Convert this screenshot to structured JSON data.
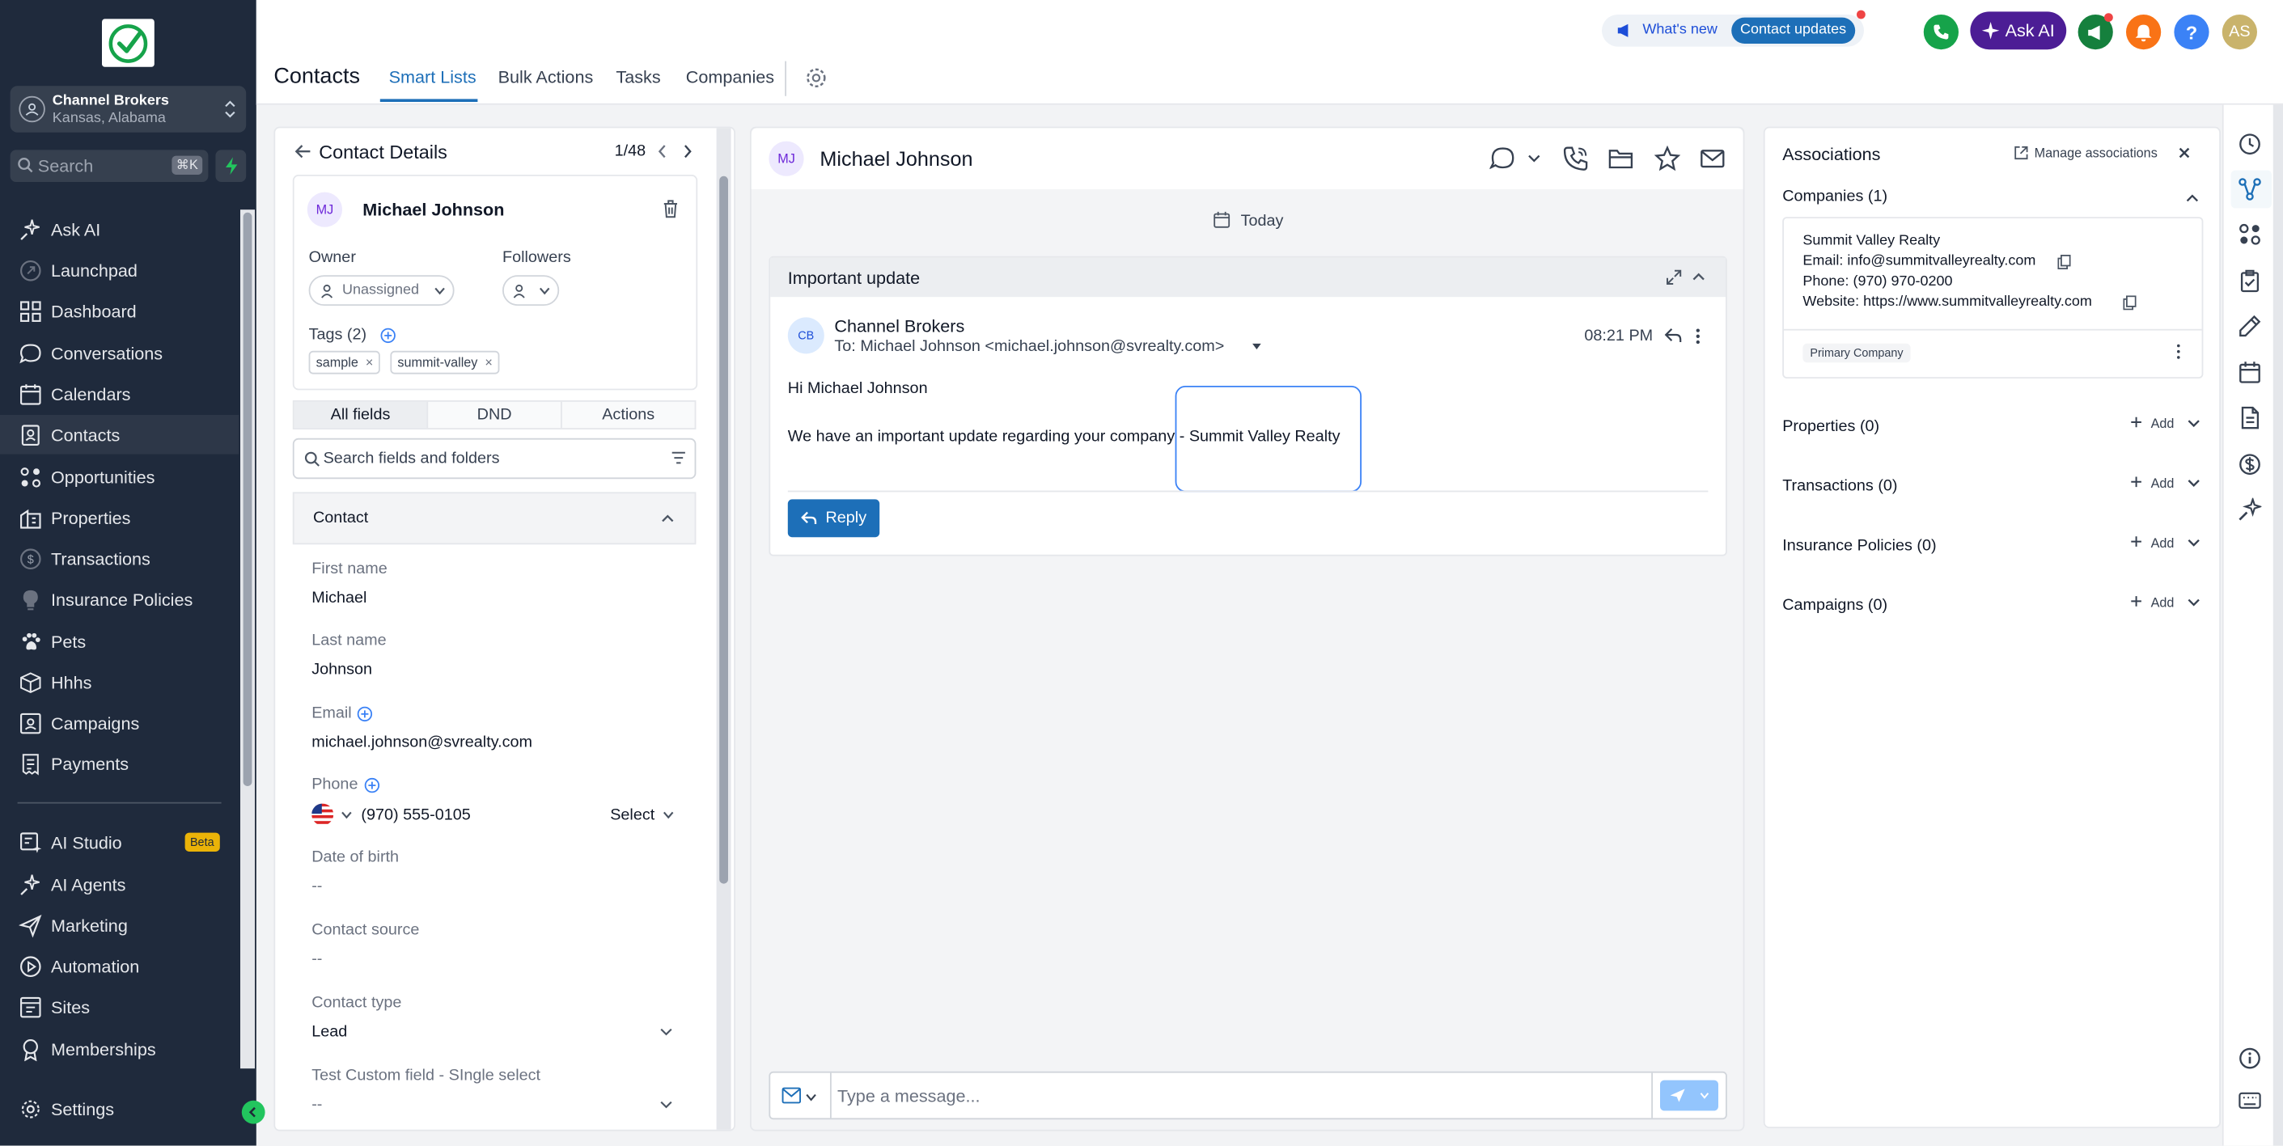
{
  "sidebar": {
    "account": {
      "name": "Channel Brokers",
      "location": "Kansas, Alabama"
    },
    "search": {
      "placeholder": "Search",
      "shortcut": "⌘K"
    },
    "items": [
      {
        "label": "Ask AI",
        "icon": "sparkles-icon"
      },
      {
        "label": "Launchpad",
        "icon": "rocket-icon"
      },
      {
        "label": "Dashboard",
        "icon": "grid-icon"
      },
      {
        "label": "Conversations",
        "icon": "chat-icon"
      },
      {
        "label": "Calendars",
        "icon": "calendar-icon"
      },
      {
        "label": "Contacts",
        "icon": "contacts-icon"
      },
      {
        "label": "Opportunities",
        "icon": "pipeline-icon"
      },
      {
        "label": "Properties",
        "icon": "building-icon"
      },
      {
        "label": "Transactions",
        "icon": "dollar-icon"
      },
      {
        "label": "Insurance Policies",
        "icon": "bulb-icon"
      },
      {
        "label": "Pets",
        "icon": "paw-icon"
      },
      {
        "label": "Hhhs",
        "icon": "box-icon"
      },
      {
        "label": "Campaigns",
        "icon": "campaign-icon"
      },
      {
        "label": "Payments",
        "icon": "receipt-icon"
      }
    ],
    "items2": [
      {
        "label": "AI Studio",
        "icon": "ai-studio-icon",
        "badge": "Beta"
      },
      {
        "label": "AI Agents",
        "icon": "sparkles-icon"
      },
      {
        "label": "Marketing",
        "icon": "send-icon"
      },
      {
        "label": "Automation",
        "icon": "automation-icon"
      },
      {
        "label": "Sites",
        "icon": "sites-icon"
      },
      {
        "label": "Memberships",
        "icon": "badge-icon"
      }
    ],
    "settings": "Settings"
  },
  "header": {
    "title": "Contacts",
    "tabs": [
      "Smart Lists",
      "Bulk Actions",
      "Tasks",
      "Companies"
    ],
    "whats_new": "What's new",
    "contact_updates": "Contact updates",
    "ask_ai": "Ask AI",
    "avatar": "AS"
  },
  "contact_details": {
    "back_title": "Contact Details",
    "pager": "1/48",
    "initials": "MJ",
    "name": "Michael Johnson",
    "owner_label": "Owner",
    "owner_value": "Unassigned",
    "followers_label": "Followers",
    "tags_label": "Tags (2)",
    "tags": [
      "sample",
      "summit-valley"
    ],
    "subtabs": [
      "All fields",
      "DND",
      "Actions"
    ],
    "search_placeholder": "Search fields and folders",
    "section": "Contact",
    "fields": {
      "first_name_label": "First name",
      "first_name": "Michael",
      "last_name_label": "Last name",
      "last_name": "Johnson",
      "email_label": "Email",
      "email": "michael.johnson@svrealty.com",
      "phone_label": "Phone",
      "phone": "(970) 555-0105",
      "phone_select": "Select",
      "dob_label": "Date of birth",
      "dob": "--",
      "source_label": "Contact source",
      "source": "--",
      "type_label": "Contact type",
      "type": "Lead",
      "custom_label": "Test Custom field - SIngle select",
      "custom": "--"
    }
  },
  "conversation": {
    "initials": "MJ",
    "name": "Michael Johnson",
    "date_chip": "Today",
    "subject": "Important update",
    "from_initials": "CB",
    "from": "Channel Brokers",
    "to": "To: Michael Johnson <michael.johnson@svrealty.com>",
    "time": "08:21 PM",
    "greeting": "Hi Michael Johnson",
    "body": "We have an important update regarding your company - Summit Valley Realty",
    "reply": "Reply",
    "composer_placeholder": "Type a message..."
  },
  "associations": {
    "title": "Associations",
    "manage": "Manage associations",
    "companies_label": "Companies (1)",
    "company": {
      "name": "Summit Valley Realty",
      "email": "Email: info@summitvalleyrealty.com",
      "phone": "Phone: (970) 970-0200",
      "website": "Website: https://www.summitvalleyrealty.com",
      "badge": "Primary Company"
    },
    "sections": [
      {
        "label": "Properties (0)",
        "add": "Add"
      },
      {
        "label": "Transactions (0)",
        "add": "Add"
      },
      {
        "label": "Insurance Policies (0)",
        "add": "Add"
      },
      {
        "label": "Campaigns (0)",
        "add": "Add"
      }
    ]
  }
}
